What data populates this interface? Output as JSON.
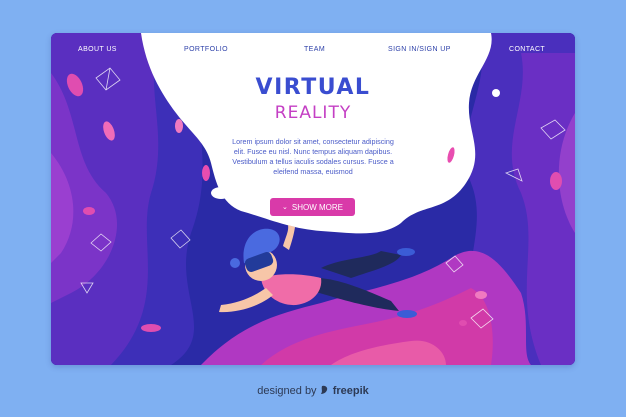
{
  "nav": {
    "about": "ABOUT US",
    "portfolio": "PORTFOLIO",
    "team": "TEAM",
    "signin": "SIGN IN/SIGN UP",
    "contact": "CONTACT"
  },
  "hero": {
    "title_line1": "VIRTUAL",
    "title_line2": "REALITY",
    "description": "Lorem ipsum dolor sit amet, consectetur adipiscing elit. Fusce eu nisl. Nunc tempus aliquam dapibus. Vestibulum a tellus iaculis sodales cursus. Fusce a eleifend massa, euismod",
    "cta_label": "SHOW MORE",
    "cta_icon": "chevron-down-icon"
  },
  "footer": {
    "credit_prefix": "designed by",
    "brand": "freepik",
    "brand_icon": "freepik-logo-icon"
  },
  "colors": {
    "page_bg": "#7fb0f2",
    "title_blue": "#3a4dd0",
    "title_magenta": "#c43fc4",
    "button_pink": "#d93aa9",
    "deep_blue": "#2b2aa8",
    "purple": "#7a2fc4"
  }
}
